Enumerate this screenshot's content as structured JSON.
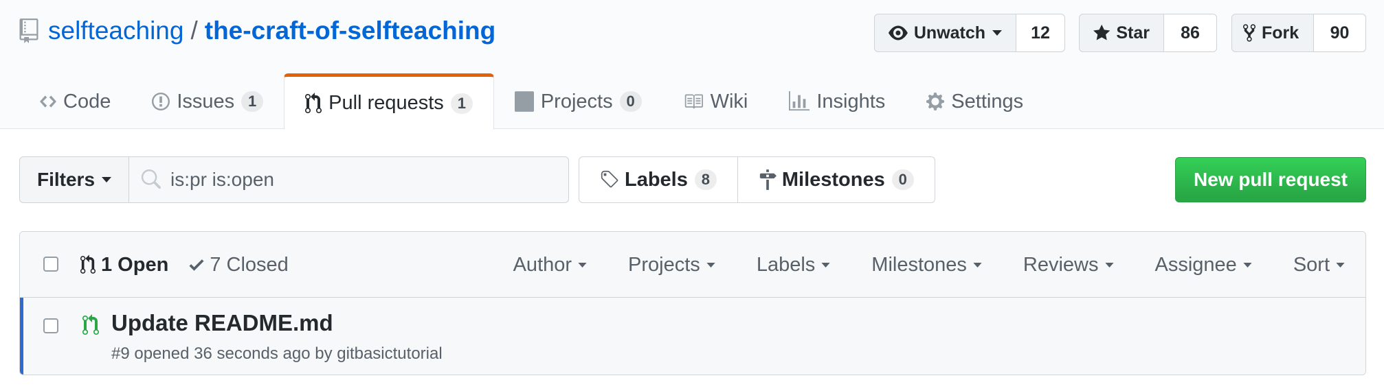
{
  "repo": {
    "owner": "selfteaching",
    "separator": "/",
    "name": "the-craft-of-selfteaching"
  },
  "actions": {
    "watch": {
      "label": "Unwatch",
      "count": "12"
    },
    "star": {
      "label": "Star",
      "count": "86"
    },
    "fork": {
      "label": "Fork",
      "count": "90"
    }
  },
  "tabs": [
    {
      "label": "Code",
      "icon": "code-icon"
    },
    {
      "label": "Issues",
      "count": "1",
      "icon": "issue-icon"
    },
    {
      "label": "Pull requests",
      "count": "1",
      "icon": "git-pull-request-icon",
      "selected": true
    },
    {
      "label": "Projects",
      "count": "0",
      "icon": "project-icon"
    },
    {
      "label": "Wiki",
      "icon": "book-icon"
    },
    {
      "label": "Insights",
      "icon": "graph-icon"
    },
    {
      "label": "Settings",
      "icon": "gear-icon"
    }
  ],
  "filters": {
    "label": "Filters",
    "search_value": "is:pr is:open"
  },
  "labels_button": {
    "label": "Labels",
    "count": "8"
  },
  "milestones_button": {
    "label": "Milestones",
    "count": "0"
  },
  "new_pr_label": "New pull request",
  "list": {
    "open_label": "1 Open",
    "closed_label": "7 Closed",
    "menus": [
      "Author",
      "Projects",
      "Labels",
      "Milestones",
      "Reviews",
      "Assignee",
      "Sort"
    ],
    "items": [
      {
        "title": "Update README.md",
        "meta": "#9 opened 36 seconds ago by gitbasictutorial"
      }
    ]
  },
  "colors": {
    "link": "#0366d6",
    "selected_tab_border": "#e36209",
    "new_pr_green": "#28a745",
    "open_green": "#28a745",
    "row_accent": "#2f6bce"
  }
}
